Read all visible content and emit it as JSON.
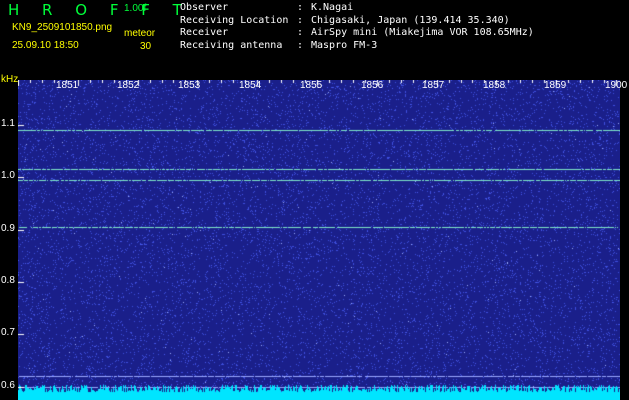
{
  "header": {
    "app_title": "H R O F F T",
    "version": "1.00f",
    "filename": "KN9_2509101850.png",
    "datetime": "25.09.10 18:50",
    "meteor_label": "meteor",
    "meteor_count": "30"
  },
  "info": [
    {
      "key": "Observer",
      "value": "K.Nagai"
    },
    {
      "key": "Receiving Location",
      "value": "Chigasaki, Japan (139.414 35.340)"
    },
    {
      "key": "Receiver",
      "value": "AirSpy mini (Miakejima VOR 108.65MHz)"
    },
    {
      "key": "Receiving antenna",
      "value": "Maspro FM-3"
    }
  ],
  "chart_data": {
    "type": "heatmap",
    "yunit": "kHz",
    "y_ticks": [
      "1.1",
      "1.0",
      "0.9",
      "0.8",
      "0.7",
      "0.6"
    ],
    "y_tick_values": [
      1.1,
      1.0,
      0.9,
      0.8,
      0.7,
      0.6
    ],
    "x_ticks": [
      "1851",
      "1852",
      "1853",
      "1854",
      "1855",
      "1856",
      "1857",
      "1858",
      "1859",
      "1900"
    ],
    "ylim": [
      0.575,
      1.185
    ],
    "xlim": [
      "1850",
      "1900"
    ],
    "carrier_lines_khz": [
      1.09,
      1.015,
      0.995,
      0.905,
      0.62,
      0.6
    ],
    "colors": {
      "background": "#1a1f8a",
      "noise": "#3f4fe0",
      "signal": "#7fe8c8",
      "bottom_band": "#00e5ff"
    }
  }
}
